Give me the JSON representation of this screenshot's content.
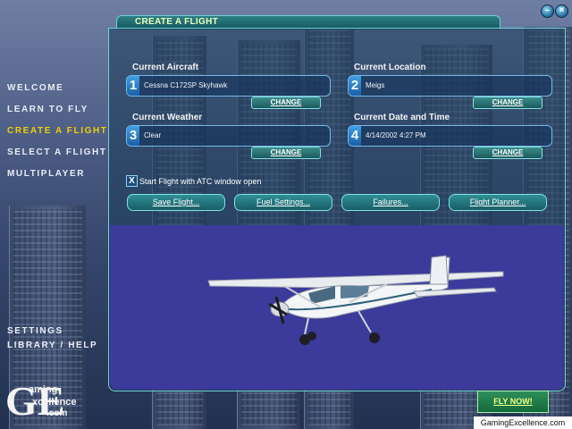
{
  "window": {
    "title": "CREATE A FLIGHT"
  },
  "nav": {
    "items": [
      "WELCOME",
      "LEARN TO FLY",
      "CREATE A FLIGHT",
      "SELECT A FLIGHT",
      "MULTIPLAYER"
    ],
    "active_index": 2,
    "bottom": [
      "SETTINGS",
      "LIBRARY / HELP"
    ]
  },
  "sections": {
    "aircraft": {
      "label": "Current Aircraft",
      "number": "1",
      "value": "Cessna C172SP Skyhawk",
      "button": "CHANGE"
    },
    "location": {
      "label": "Current Location",
      "number": "2",
      "value": "Meigs",
      "button": "CHANGE"
    },
    "weather": {
      "label": "Current Weather",
      "number": "3",
      "value": "Clear",
      "button": "CHANGE"
    },
    "datetime": {
      "label": "Current Date and Time",
      "number": "4",
      "value": "4/14/2002 4:27 PM",
      "button": "CHANGE"
    }
  },
  "atc_option": {
    "label": "Start Flight with ATC window open",
    "checked": true,
    "mark": "X"
  },
  "actions": [
    "Save Flight...",
    "Fuel Settings...",
    "Failures...",
    "Flight Planner..."
  ],
  "fly_now": "FLY NOW!",
  "logo": {
    "letters": "GE",
    "line1": "aming",
    "line2": "xcellence",
    "line3": ".com"
  },
  "footer": "GamingExcellence.com",
  "colors": {
    "accent": "#6fd0d4",
    "active_nav": "#f0d000",
    "preview_bg": "#3c3a9a"
  }
}
